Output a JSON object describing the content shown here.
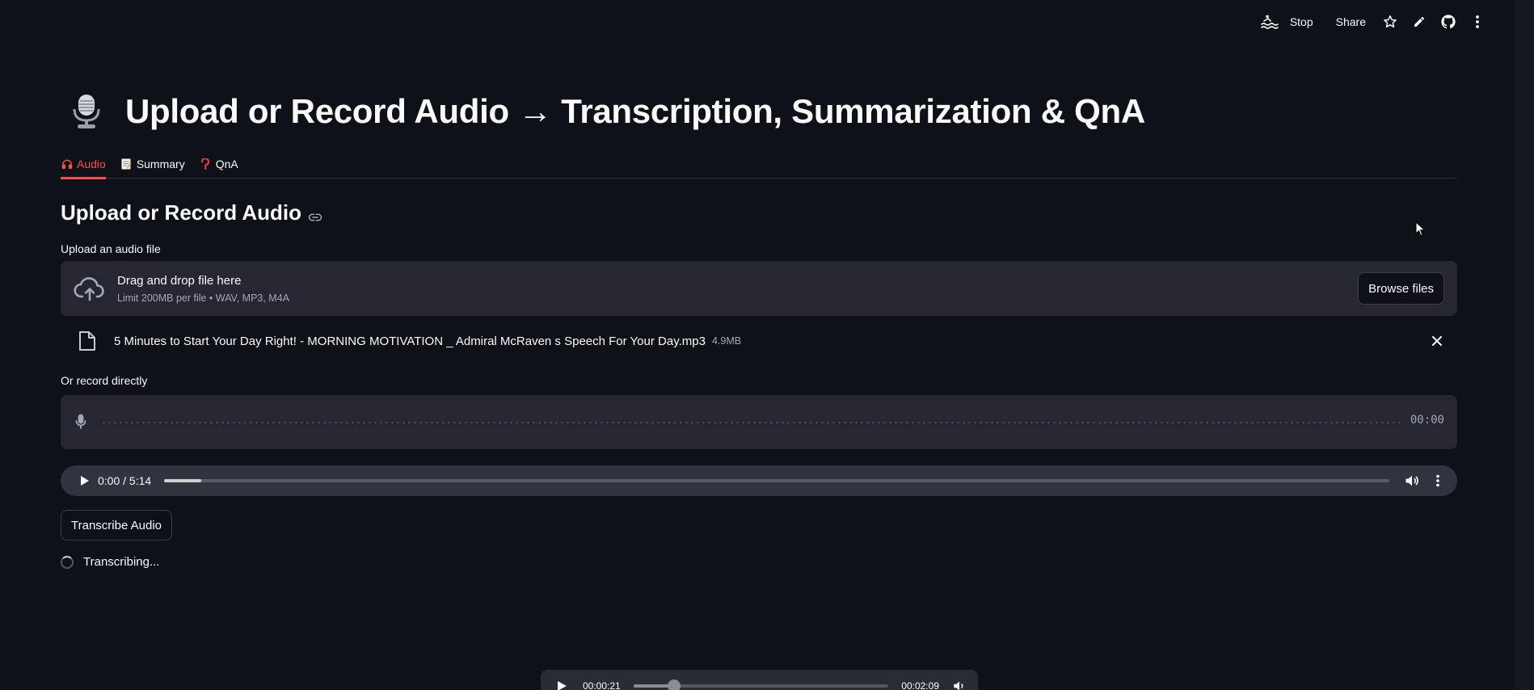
{
  "toolbar": {
    "stop_label": "Stop",
    "share_label": "Share"
  },
  "header": {
    "title": "Upload or Record Audio → Transcription, Summarization & QnA"
  },
  "tabs": [
    {
      "label": "Audio",
      "icon": "headphones-icon",
      "active": true
    },
    {
      "label": "Summary",
      "icon": "memo-icon",
      "active": false
    },
    {
      "label": "QnA",
      "icon": "question-mark-icon",
      "active": false
    }
  ],
  "section": {
    "title": "Upload or Record Audio"
  },
  "uploader": {
    "label": "Upload an audio file",
    "drop_text": "Drag and drop file here",
    "limit_text": "Limit 200MB per file • WAV, MP3, M4A",
    "browse_label": "Browse files",
    "file": {
      "name": "5 Minutes to Start Your Day Right! - MORNING MOTIVATION _ Admiral McRaven s Speech For Your Day.mp3",
      "size": "4.9MB"
    }
  },
  "recorder": {
    "label": "Or record directly",
    "time": "00:00"
  },
  "player": {
    "time": "0:00 / 5:14",
    "buffered_fraction": 0.03
  },
  "transcribe": {
    "button_label": "Transcribe Audio",
    "status_text": "Transcribing..."
  },
  "mini_player": {
    "current_time": "00:00:21",
    "total_time": "00:02:09",
    "progress_fraction": 0.16
  },
  "colors": {
    "background": "#0e1117",
    "accent": "#ff4b4b",
    "panel": "#262730"
  }
}
